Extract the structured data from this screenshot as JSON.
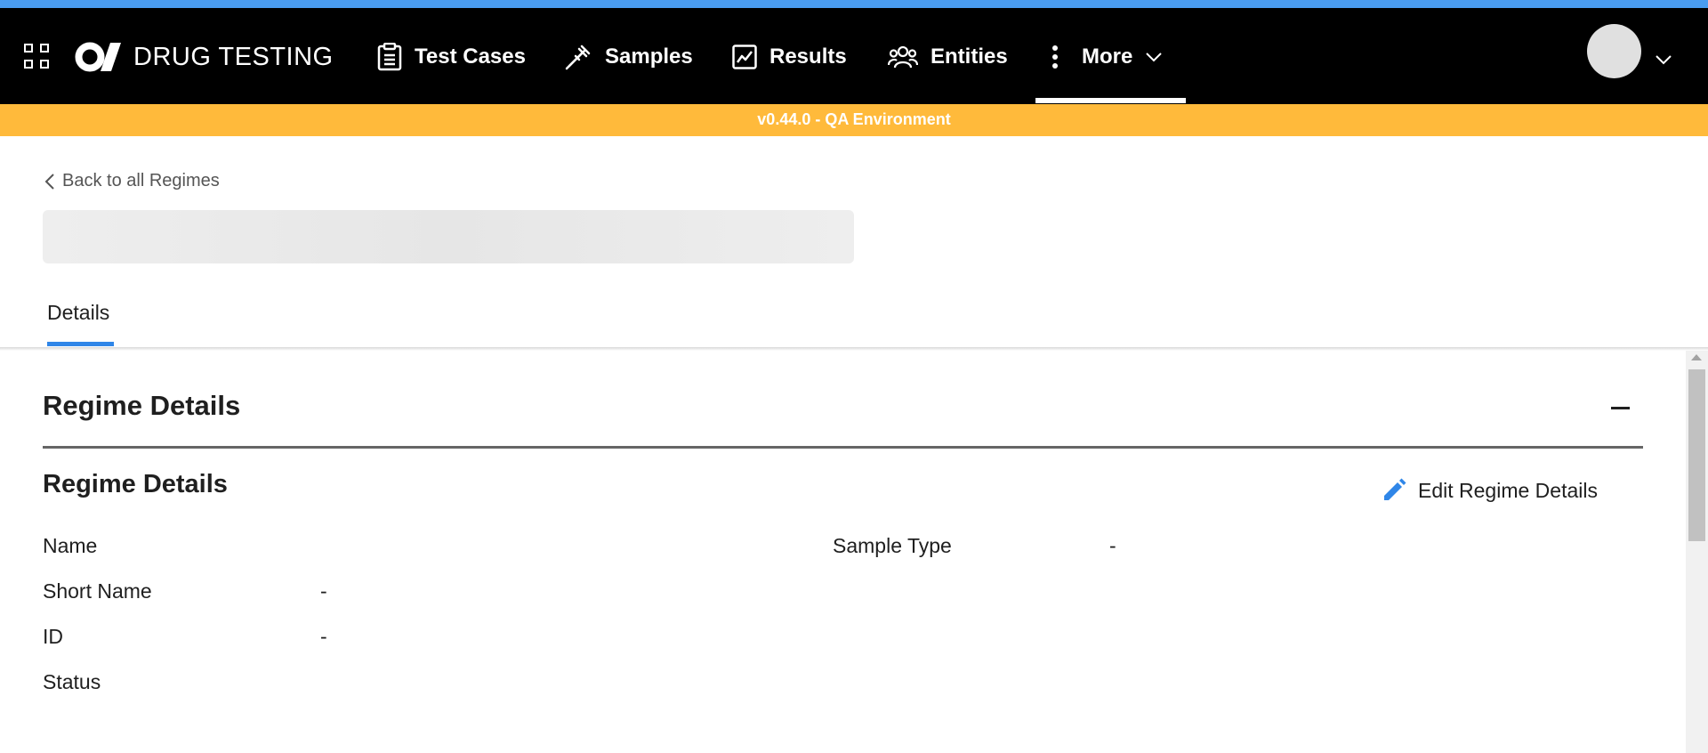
{
  "app": {
    "brand": "DRUG TESTING",
    "accent_color": "#4a9cf0",
    "nav_background": "#000000",
    "env_banner_color": "#ffba3b",
    "primary_blue": "#2f86e8"
  },
  "nav": {
    "apps_icon": "grid-icon",
    "logo_icon": "company-logo-icon",
    "items": [
      {
        "label": "Test Cases",
        "icon": "clipboard-icon"
      },
      {
        "label": "Samples",
        "icon": "pipette-icon"
      },
      {
        "label": "Results",
        "icon": "chart-line-icon"
      },
      {
        "label": "Entities",
        "icon": "users-icon"
      },
      {
        "label": "More",
        "icon": "more-vertical-icon",
        "active": true
      }
    ],
    "user_menu_icon": "chevron-down-icon"
  },
  "env_banner": {
    "text": "v0.44.0 - QA Environment"
  },
  "page": {
    "back_link": "Back to all Regimes",
    "tabs": [
      {
        "label": "Details",
        "active": true
      }
    ]
  },
  "section": {
    "title": "Regime Details",
    "subtitle": "Regime Details",
    "edit_label": "Edit Regime Details",
    "fields_left": [
      {
        "label": "Name",
        "value": ""
      },
      {
        "label": "Short Name",
        "value": "-"
      },
      {
        "label": "ID",
        "value": "-"
      },
      {
        "label": "Status",
        "value": ""
      }
    ],
    "fields_right": [
      {
        "label": "Sample Type",
        "value": "-"
      }
    ]
  }
}
